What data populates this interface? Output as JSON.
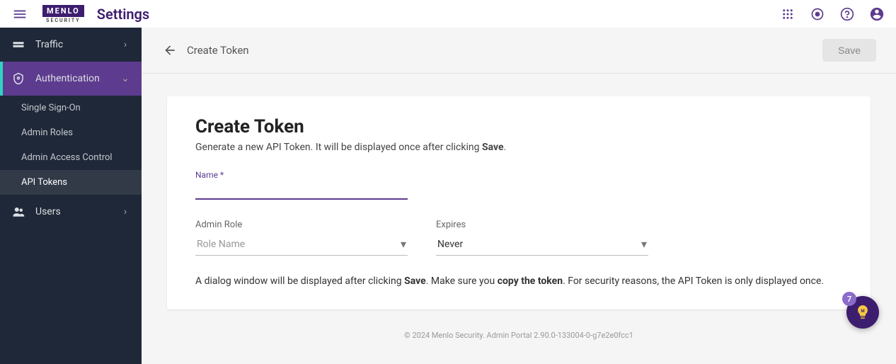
{
  "header": {
    "logo_main": "MENLO",
    "logo_sub": "SECURITY",
    "page_title": "Settings"
  },
  "sidebar": {
    "items": [
      {
        "label": "Traffic"
      },
      {
        "label": "Authentication"
      },
      {
        "label": "Users"
      }
    ],
    "subitems": [
      {
        "label": "Single Sign-On"
      },
      {
        "label": "Admin Roles"
      },
      {
        "label": "Admin Access Control"
      },
      {
        "label": "API Tokens"
      }
    ]
  },
  "subheader": {
    "title": "Create Token",
    "save_label": "Save"
  },
  "card": {
    "title": "Create Token",
    "desc_pre": "Generate a new API Token. It will be displayed once after clicking ",
    "desc_bold": "Save",
    "desc_post": ".",
    "name_label": "Name",
    "required": "*",
    "role_label": "Admin Role",
    "role_placeholder": "Role Name",
    "expires_label": "Expires",
    "expires_value": "Never",
    "note_1": "A dialog window will be displayed after clicking ",
    "note_2": "Save",
    "note_3": ". Make sure you ",
    "note_4": "copy the token",
    "note_5": ". For security reasons, the API Token is only displayed once."
  },
  "footer": {
    "text": "© 2024 Menlo Security. Admin Portal 2.90.0-133004-0-g7e2e0fcc1"
  },
  "fab": {
    "badge": "7"
  }
}
